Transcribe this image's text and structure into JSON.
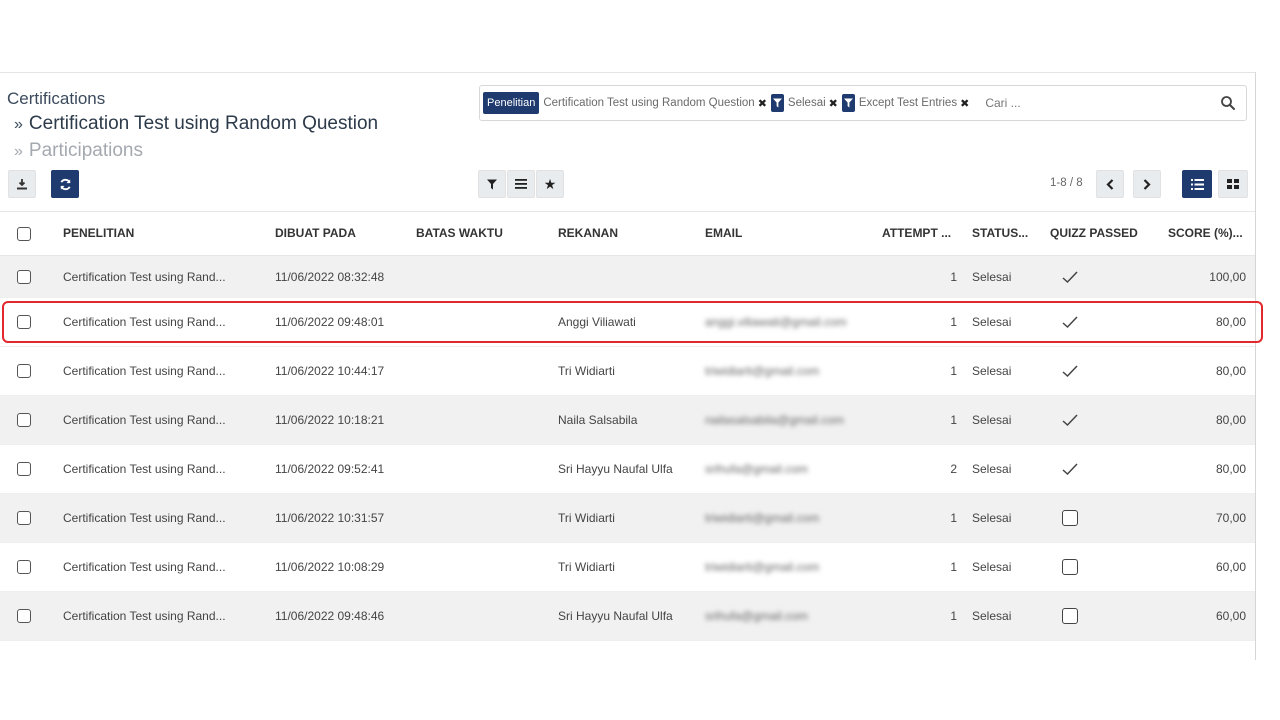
{
  "breadcrumb": {
    "root": "Certifications",
    "level2": "Certification Test using Random Question",
    "level3": "Participations",
    "separator": "»"
  },
  "search": {
    "facets": [
      {
        "type": "group",
        "tag": "Penelitian",
        "value": "Certification Test using Random Question"
      },
      {
        "type": "filter",
        "value": "Selesai"
      },
      {
        "type": "filter",
        "value": "Except Test Entries"
      }
    ],
    "placeholder": "Cari ..."
  },
  "pager": {
    "value": "1-8 / 8"
  },
  "columns": {
    "penelitian": "PENELITIAN",
    "dibuat_pada": "DIBUAT PADA",
    "batas_waktu": "BATAS WAKTU",
    "rekanan": "REKANAN",
    "email": "EMAIL",
    "attempt": "ATTEMPT ...",
    "status": "STATUS...",
    "quizz_passed": "QUIZZ PASSED",
    "score": "SCORE (%)..."
  },
  "rows": [
    {
      "penelitian": "Certification Test using Rand...",
      "dibuat_pada": "11/06/2022 08:32:48",
      "rekanan": "",
      "email": "",
      "attempt": "1",
      "status": "Selesai",
      "passed": true,
      "score": "100,00"
    },
    {
      "penelitian": "Certification Test using Rand...",
      "dibuat_pada": "11/06/2022 09:48:01",
      "rekanan": "Anggi Viliawati",
      "email": "anggi.viliawati@gmail.com",
      "attempt": "1",
      "status": "Selesai",
      "passed": true,
      "score": "80,00"
    },
    {
      "penelitian": "Certification Test using Rand...",
      "dibuat_pada": "11/06/2022 10:44:17",
      "rekanan": "Tri Widiarti",
      "email": "triwidiarti@gmail.com",
      "attempt": "1",
      "status": "Selesai",
      "passed": true,
      "score": "80,00"
    },
    {
      "penelitian": "Certification Test using Rand...",
      "dibuat_pada": "11/06/2022 10:18:21",
      "rekanan": "Naila Salsabila",
      "email": "nailasalsabila@gmail.com",
      "attempt": "1",
      "status": "Selesai",
      "passed": true,
      "score": "80,00"
    },
    {
      "penelitian": "Certification Test using Rand...",
      "dibuat_pada": "11/06/2022 09:52:41",
      "rekanan": "Sri Hayyu Naufal Ulfa",
      "email": "srihufa@gmail.com",
      "attempt": "2",
      "status": "Selesai",
      "passed": true,
      "score": "80,00"
    },
    {
      "penelitian": "Certification Test using Rand...",
      "dibuat_pada": "11/06/2022 10:31:57",
      "rekanan": "Tri Widiarti",
      "email": "triwidiarti@gmail.com",
      "attempt": "1",
      "status": "Selesai",
      "passed": false,
      "score": "70,00"
    },
    {
      "penelitian": "Certification Test using Rand...",
      "dibuat_pada": "11/06/2022 10:08:29",
      "rekanan": "Tri Widiarti",
      "email": "triwidiarti@gmail.com",
      "attempt": "1",
      "status": "Selesai",
      "passed": false,
      "score": "60,00"
    },
    {
      "penelitian": "Certification Test using Rand...",
      "dibuat_pada": "11/06/2022 09:48:46",
      "rekanan": "Sri Hayyu Naufal Ulfa",
      "email": "srihufa@gmail.com",
      "attempt": "1",
      "status": "Selesai",
      "passed": false,
      "score": "60,00"
    }
  ],
  "colors": {
    "accent": "#1e3a6e",
    "row_shade": "#f1f1f1",
    "highlight": "#e3282d"
  },
  "icons": [
    "download-icon",
    "refresh-icon",
    "filter-icon",
    "group-by-icon",
    "favorite-star-icon",
    "chevron-left-icon",
    "chevron-right-icon",
    "list-view-icon",
    "kanban-view-icon",
    "search-icon",
    "remove-facet-icon",
    "checkmark-icon"
  ]
}
